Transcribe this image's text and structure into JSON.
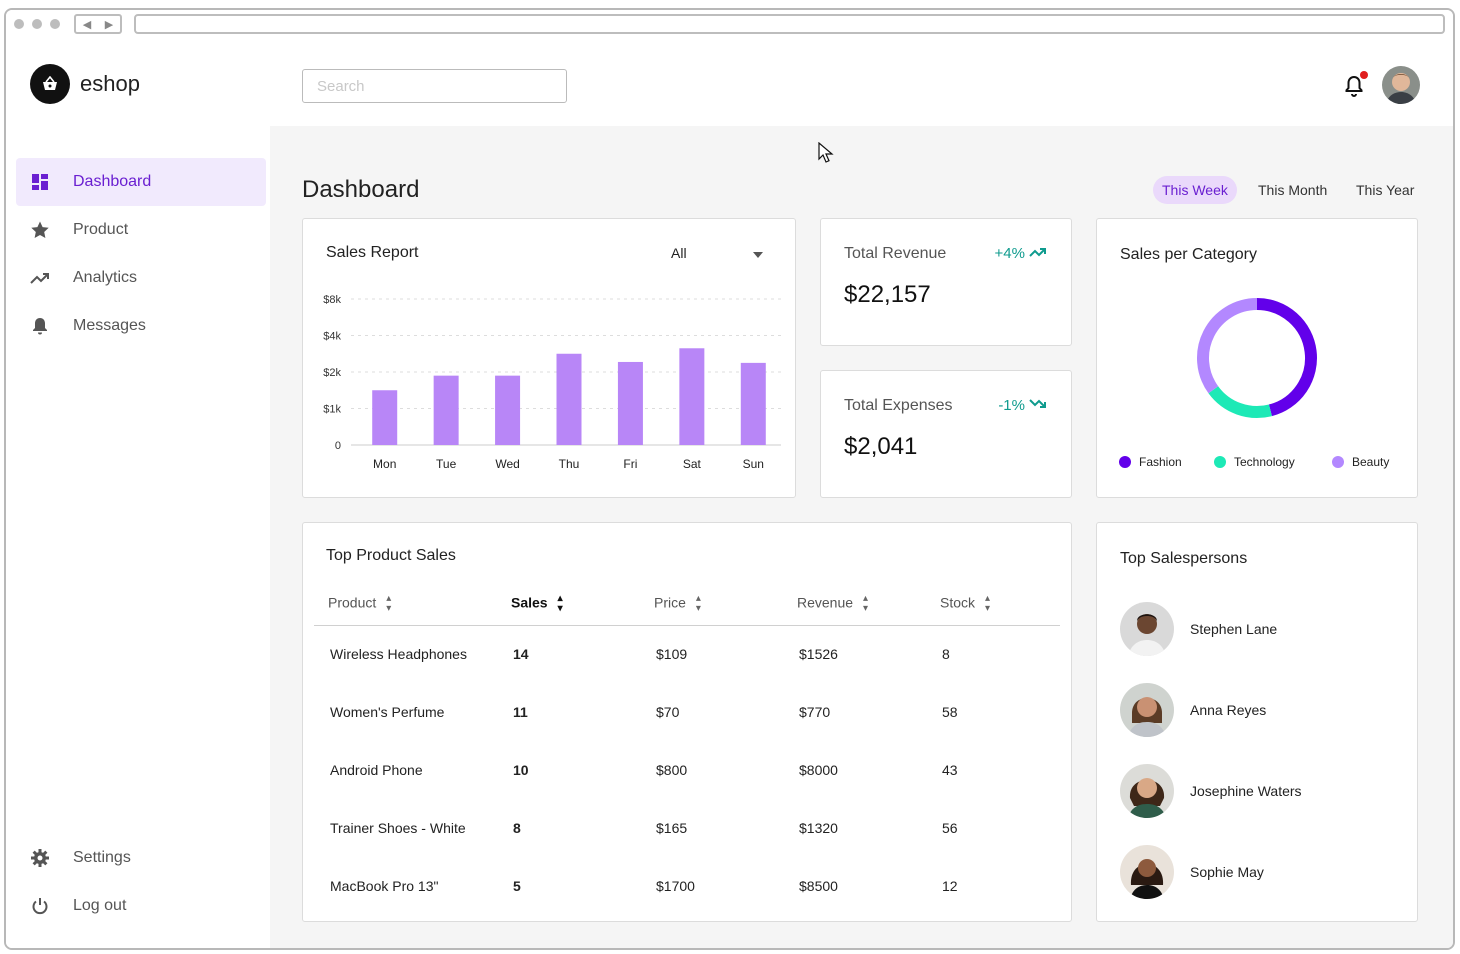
{
  "app": {
    "name": "eshop"
  },
  "search": {
    "placeholder": "Search"
  },
  "sidebar": {
    "items": [
      {
        "label": "Dashboard",
        "icon": "dashboard-icon",
        "active": true
      },
      {
        "label": "Product",
        "icon": "star-icon"
      },
      {
        "label": "Analytics",
        "icon": "trending-up-icon"
      },
      {
        "label": "Messages",
        "icon": "bell-icon"
      }
    ],
    "bottom": [
      {
        "label": "Settings",
        "icon": "gear-icon"
      },
      {
        "label": "Log out",
        "icon": "power-icon"
      }
    ]
  },
  "page": {
    "title": "Dashboard"
  },
  "ranges": [
    "This Week",
    "This Month",
    "This Year"
  ],
  "sales_report": {
    "title": "Sales Report",
    "filter": "All"
  },
  "revenue": {
    "label": "Total Revenue",
    "change": "+4%",
    "value": "$22,157"
  },
  "expenses": {
    "label": "Total Expenses",
    "change": "-1%",
    "value": "$2,041"
  },
  "category": {
    "title": "Sales per Category",
    "legend": [
      {
        "label": "Fashion",
        "color": "#6200ea"
      },
      {
        "label": "Technology",
        "color": "#1de9b6"
      },
      {
        "label": "Beauty",
        "color": "#b388ff"
      }
    ]
  },
  "products": {
    "title": "Top Product Sales",
    "headers": [
      "Product",
      "Sales",
      "Price",
      "Revenue",
      "Stock"
    ],
    "rows": [
      [
        "Wireless Headphones",
        "14",
        "$109",
        "$1526",
        "8"
      ],
      [
        "Women's Perfume",
        "11",
        "$70",
        "$770",
        "58"
      ],
      [
        "Android Phone",
        "10",
        "$800",
        "$8000",
        "43"
      ],
      [
        "Trainer Shoes - White",
        "8",
        "$165",
        "$1320",
        "56"
      ],
      [
        "MacBook Pro 13\"",
        "5",
        "$1700",
        "$8500",
        "12"
      ]
    ]
  },
  "salespersons": {
    "title": "Top Salespersons",
    "people": [
      "Stephen Lane",
      "Anna Reyes",
      "Josephine Waters",
      "Sophie May"
    ]
  },
  "chart_data": [
    {
      "type": "bar",
      "categories": [
        "Mon",
        "Tue",
        "Wed",
        "Thu",
        "Fri",
        "Sat",
        "Sun"
      ],
      "values": [
        1500,
        1900,
        1900,
        3000,
        2550,
        3300,
        2500
      ],
      "ytick_labels": [
        "0",
        "$1k",
        "$2k",
        "$4k",
        "$8k"
      ],
      "color": "#b886f7",
      "grid": true
    },
    {
      "type": "pie",
      "style": "donut",
      "labels": [
        "Fashion",
        "Technology",
        "Beauty"
      ],
      "values": [
        46,
        19,
        35
      ],
      "colors": [
        "#6200ea",
        "#1de9b6",
        "#b388ff"
      ]
    }
  ]
}
